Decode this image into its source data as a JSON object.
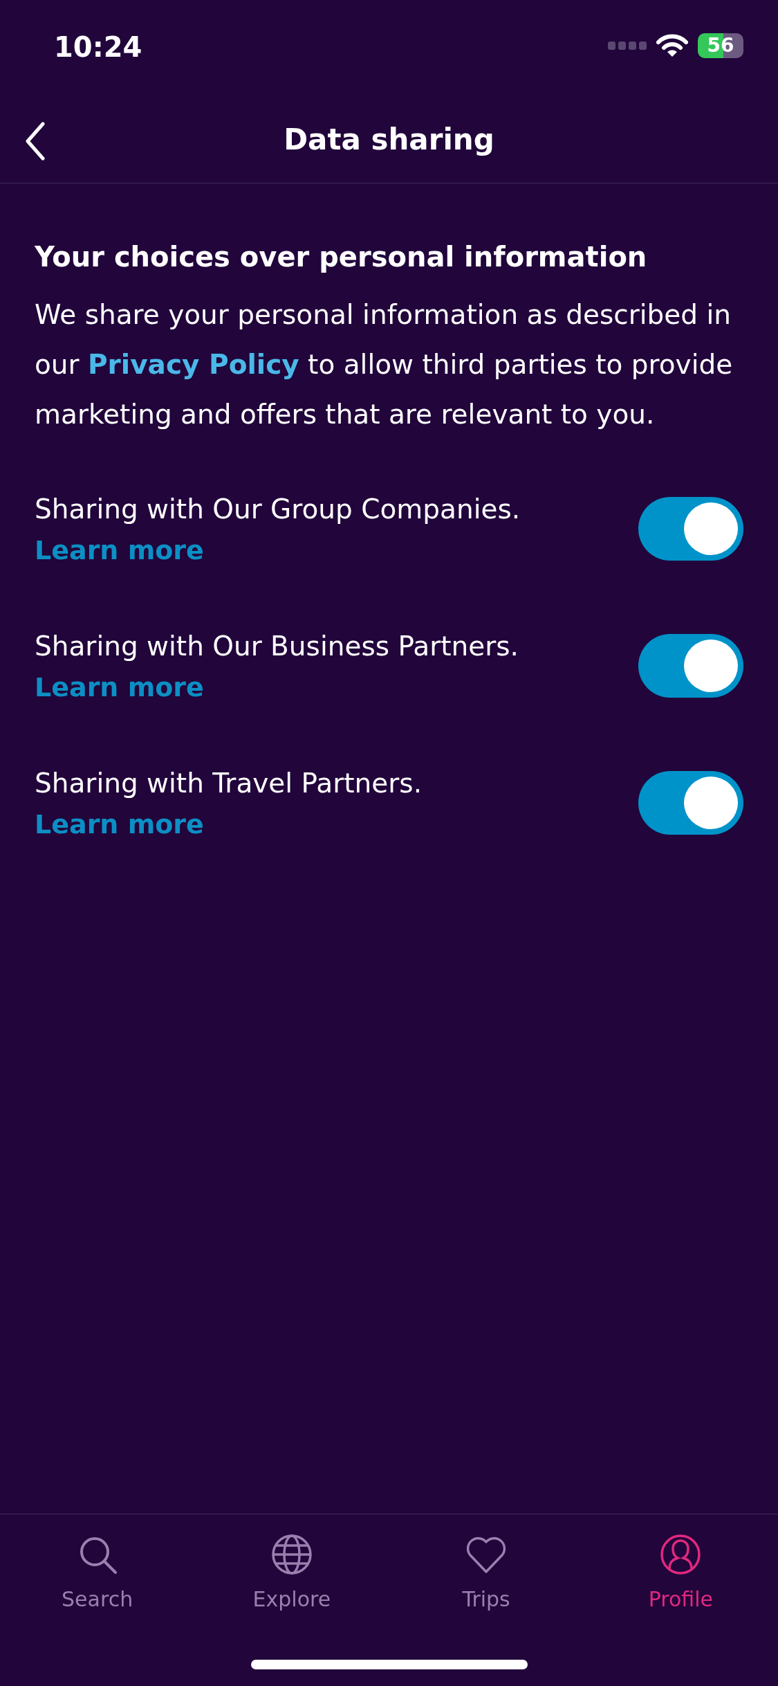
{
  "status_bar": {
    "time": "10:24",
    "battery": "56"
  },
  "nav": {
    "title": "Data sharing"
  },
  "section": {
    "heading": "Your choices over personal information",
    "intro": {
      "before": "We share your personal information as described in our ",
      "link": "Privacy Policy",
      "after": " to allow third parties to provide marketing and offers that are relevant to you."
    }
  },
  "settings": [
    {
      "label": "Sharing with Our Group Companies.",
      "link": "Learn more",
      "on": true
    },
    {
      "label": "Sharing with Our Business Partners.",
      "link": "Learn more",
      "on": true
    },
    {
      "label": "Sharing with Travel Partners.",
      "link": "Learn more",
      "on": true
    }
  ],
  "tabs": [
    {
      "kind": "search",
      "label": "Search",
      "selected": false
    },
    {
      "kind": "explore",
      "label": "Explore",
      "selected": false
    },
    {
      "kind": "trips",
      "label": "Trips",
      "selected": false
    },
    {
      "kind": "profile",
      "label": "Profile",
      "selected": true
    }
  ]
}
